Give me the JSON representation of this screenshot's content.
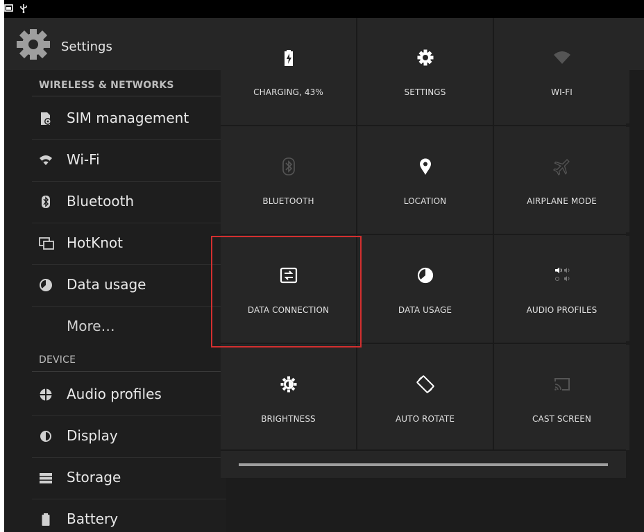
{
  "settings": {
    "title": "Settings",
    "categories": {
      "wireless": "WIRELESS & NETWORKS",
      "device": "DEVICE"
    },
    "items": [
      {
        "label": "SIM management",
        "icon": "sim-management-icon"
      },
      {
        "label": "Wi-Fi",
        "icon": "wifi-icon"
      },
      {
        "label": "Bluetooth",
        "icon": "bluetooth-icon"
      },
      {
        "label": "HotKnot",
        "icon": "hotknot-icon"
      },
      {
        "label": "Data usage",
        "icon": "data-usage-icon"
      },
      {
        "label": "More…",
        "icon": ""
      },
      {
        "label": "Audio profiles",
        "icon": "audio-profiles-icon"
      },
      {
        "label": "Display",
        "icon": "display-icon"
      },
      {
        "label": "Storage",
        "icon": "storage-icon"
      },
      {
        "label": "Battery",
        "icon": "battery-icon"
      }
    ]
  },
  "quick_settings": {
    "tiles": [
      {
        "label": "CHARGING, 43%",
        "icon": "battery-charging-icon",
        "enabled": true
      },
      {
        "label": "SETTINGS",
        "icon": "gear-icon",
        "enabled": true
      },
      {
        "label": "WI-FI",
        "icon": "wifi-icon",
        "enabled": false
      },
      {
        "label": "BLUETOOTH",
        "icon": "bluetooth-icon",
        "enabled": false
      },
      {
        "label": "LOCATION",
        "icon": "location-pin-icon",
        "enabled": true
      },
      {
        "label": "AIRPLANE MODE",
        "icon": "airplane-icon",
        "enabled": false
      },
      {
        "label": "DATA CONNECTION",
        "icon": "data-connection-icon",
        "enabled": true
      },
      {
        "label": "DATA USAGE",
        "icon": "data-usage-icon",
        "enabled": true
      },
      {
        "label": "AUDIO PROFILES",
        "icon": "audio-profiles-icon",
        "enabled": true
      },
      {
        "label": "BRIGHTNESS",
        "icon": "brightness-icon",
        "enabled": true
      },
      {
        "label": "AUTO ROTATE",
        "icon": "auto-rotate-icon",
        "enabled": true
      },
      {
        "label": "CAST SCREEN",
        "icon": "cast-screen-icon",
        "enabled": false
      }
    ],
    "battery_level_percent": 43
  },
  "colors": {
    "highlight": "#d32f2f",
    "enabled_icon": "#ffffff",
    "disabled_icon": "#555555"
  }
}
